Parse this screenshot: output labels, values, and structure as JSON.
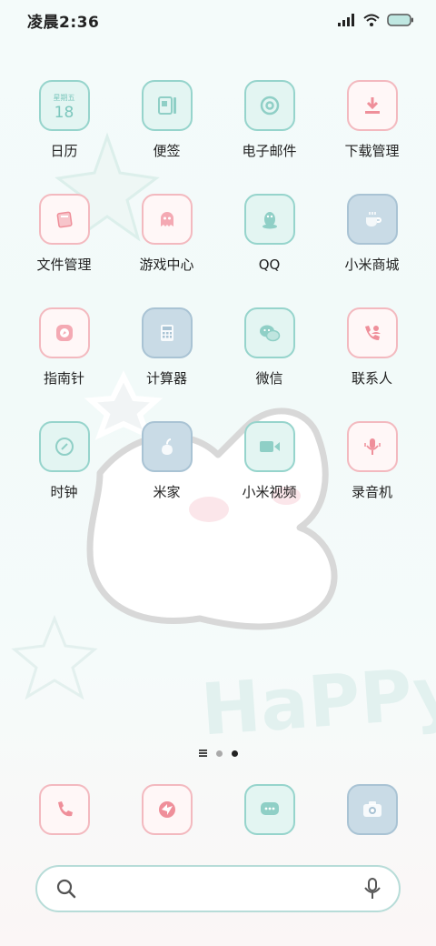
{
  "status": {
    "time": "凌晨2:36"
  },
  "apps": [
    {
      "label": "日历",
      "icon": "calendar-icon",
      "week": "星期五",
      "day": "18"
    },
    {
      "label": "便签",
      "icon": "notes-icon"
    },
    {
      "label": "电子邮件",
      "icon": "email-icon"
    },
    {
      "label": "下载管理",
      "icon": "download-icon"
    },
    {
      "label": "文件管理",
      "icon": "folder-icon"
    },
    {
      "label": "游戏中心",
      "icon": "game-ghost-icon"
    },
    {
      "label": "QQ",
      "icon": "qq-penguin-icon"
    },
    {
      "label": "小米商城",
      "icon": "coffee-cup-icon"
    },
    {
      "label": "指南针",
      "icon": "compass-icon"
    },
    {
      "label": "计算器",
      "icon": "calculator-icon"
    },
    {
      "label": "微信",
      "icon": "wechat-icon"
    },
    {
      "label": "联系人",
      "icon": "contacts-icon"
    },
    {
      "label": "时钟",
      "icon": "clock-icon"
    },
    {
      "label": "米家",
      "icon": "mijia-icon"
    },
    {
      "label": "小米视频",
      "icon": "video-camera-icon"
    },
    {
      "label": "录音机",
      "icon": "microphone-icon"
    }
  ],
  "pager": {
    "pages": 2,
    "current": 2,
    "list_icon": "page-list-icon"
  },
  "dock": [
    {
      "icon": "phone-icon"
    },
    {
      "icon": "browser-icon"
    },
    {
      "icon": "message-icon"
    },
    {
      "icon": "camera-icon"
    }
  ],
  "search": {
    "placeholder": ""
  },
  "wallpaper": {
    "text": "HaPPy!"
  },
  "colors": {
    "teal": "#96d4cc",
    "pink": "#f3b9bf",
    "blue": "#a9c3d4"
  }
}
